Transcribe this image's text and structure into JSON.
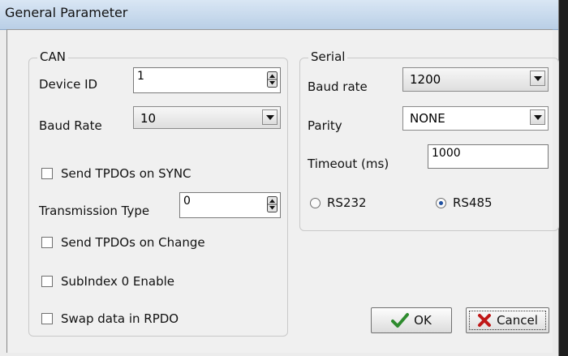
{
  "window": {
    "title": "General Parameter"
  },
  "can": {
    "legend": "CAN",
    "device_id": {
      "label": "Device ID",
      "value": "1"
    },
    "baud_rate": {
      "label": "Baud Rate",
      "value": "10"
    },
    "send_tpdos_sync": {
      "label": "Send TPDOs on SYNC",
      "checked": false
    },
    "transmission_type": {
      "label": "Transmission Type",
      "value": "0"
    },
    "send_tpdos_change": {
      "label": "Send TPDOs on Change",
      "checked": false
    },
    "subindex0": {
      "label": "SubIndex 0 Enable",
      "checked": false
    },
    "swap_rpdo": {
      "label": "Swap data in RPDO",
      "checked": false
    }
  },
  "serial": {
    "legend": "Serial",
    "baud_rate": {
      "label": "Baud rate",
      "value": "1200"
    },
    "parity": {
      "label": "Parity",
      "value": "NONE"
    },
    "timeout": {
      "label": "Timeout (ms)",
      "value": "1000"
    },
    "rs232": {
      "label": "RS232",
      "selected": false
    },
    "rs485": {
      "label": "RS485",
      "selected": true
    }
  },
  "buttons": {
    "ok": "OK",
    "cancel": "Cancel"
  },
  "colors": {
    "ok_check": "#2e8b2e",
    "cancel_x": "#c01818"
  }
}
